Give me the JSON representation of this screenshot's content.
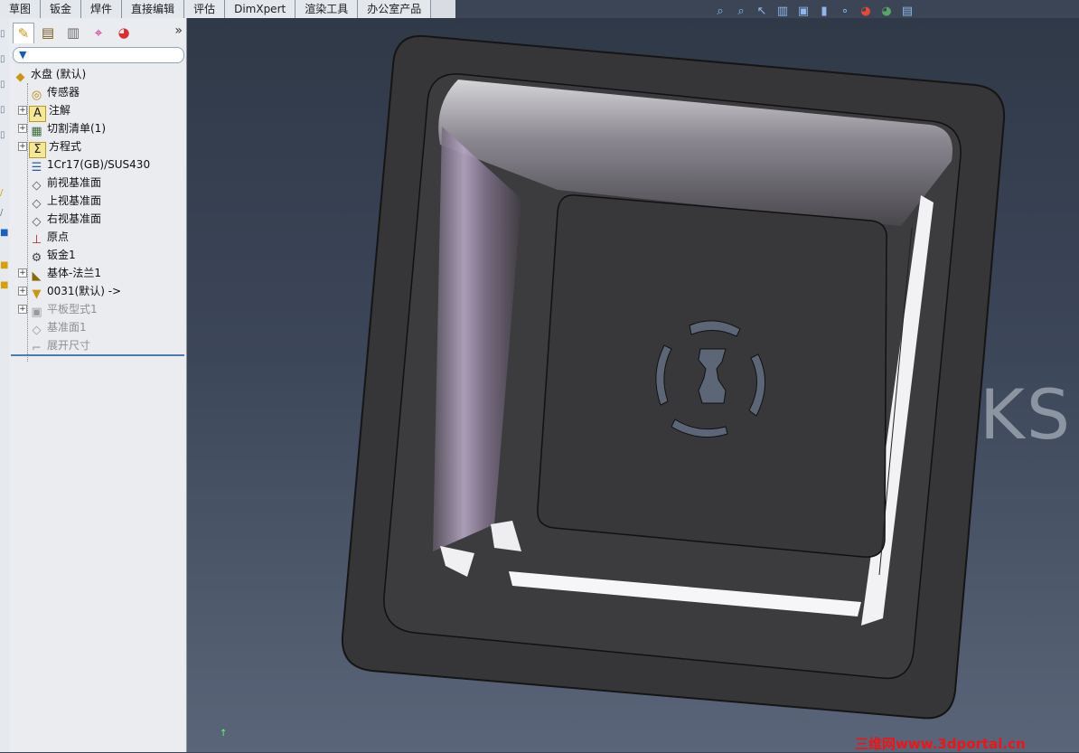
{
  "toolbar_tabs": [
    "草图",
    "钣金",
    "焊件",
    "直接编辑",
    "评估",
    "DimXpert",
    "渲染工具",
    "办公室产品"
  ],
  "panel": {
    "tabs": [
      {
        "icon": "feature-manager-icon"
      },
      {
        "icon": "property-manager-icon"
      },
      {
        "icon": "configuration-manager-icon"
      },
      {
        "icon": "dimxpert-manager-icon"
      },
      {
        "icon": "display-manager-icon"
      }
    ],
    "expand_glyph": "»"
  },
  "tree": {
    "root": "水盘 (默认)",
    "items": [
      {
        "label": "传感器",
        "icon": "sensor-icon",
        "expandable": false,
        "dim": false
      },
      {
        "label": "注解",
        "icon": "annotation-icon",
        "expandable": true,
        "dim": false
      },
      {
        "label": "切割清单(1)",
        "icon": "cut-list-icon",
        "expandable": true,
        "dim": false
      },
      {
        "label": "方程式",
        "icon": "equation-icon",
        "expandable": true,
        "dim": false
      },
      {
        "label": "1Cr17(GB)/SUS430",
        "icon": "material-icon",
        "expandable": false,
        "dim": false
      },
      {
        "label": "前视基准面",
        "icon": "plane-icon",
        "expandable": false,
        "dim": false
      },
      {
        "label": "上视基准面",
        "icon": "plane-icon",
        "expandable": false,
        "dim": false
      },
      {
        "label": "右视基准面",
        "icon": "plane-icon",
        "expandable": false,
        "dim": false
      },
      {
        "label": "原点",
        "icon": "origin-icon",
        "expandable": false,
        "dim": false
      },
      {
        "label": "钣金1",
        "icon": "sheet-metal-icon",
        "expandable": false,
        "dim": false
      },
      {
        "label": "基体-法兰1",
        "icon": "base-flange-icon",
        "expandable": true,
        "dim": false
      },
      {
        "label": "0031(默认) ->",
        "icon": "derived-part-icon",
        "expandable": true,
        "dim": false
      },
      {
        "label": "平板型式1",
        "icon": "flat-pattern-icon",
        "expandable": true,
        "dim": true
      },
      {
        "label": "基准面1",
        "icon": "plane-icon",
        "expandable": false,
        "dim": true
      },
      {
        "label": "展开尺寸",
        "icon": "unfold-dimension-icon",
        "expandable": false,
        "dim": true
      }
    ]
  },
  "viewport": {
    "watermark_text": "KS",
    "site_mark": "三维网www.3dportal.cn",
    "heads_up_icons": [
      "zoom-to-fit-icon",
      "zoom-area-icon",
      "previous-view-icon",
      "section-view-icon",
      "view-orientation-icon",
      "display-style-icon",
      "hide-show-icon",
      "edit-appearance-icon",
      "apply-scene-icon",
      "view-settings-icon"
    ],
    "colors": {
      "background_top": "#2f3947",
      "background_bottom": "#5a6579",
      "part": "#3a3a3b"
    }
  }
}
